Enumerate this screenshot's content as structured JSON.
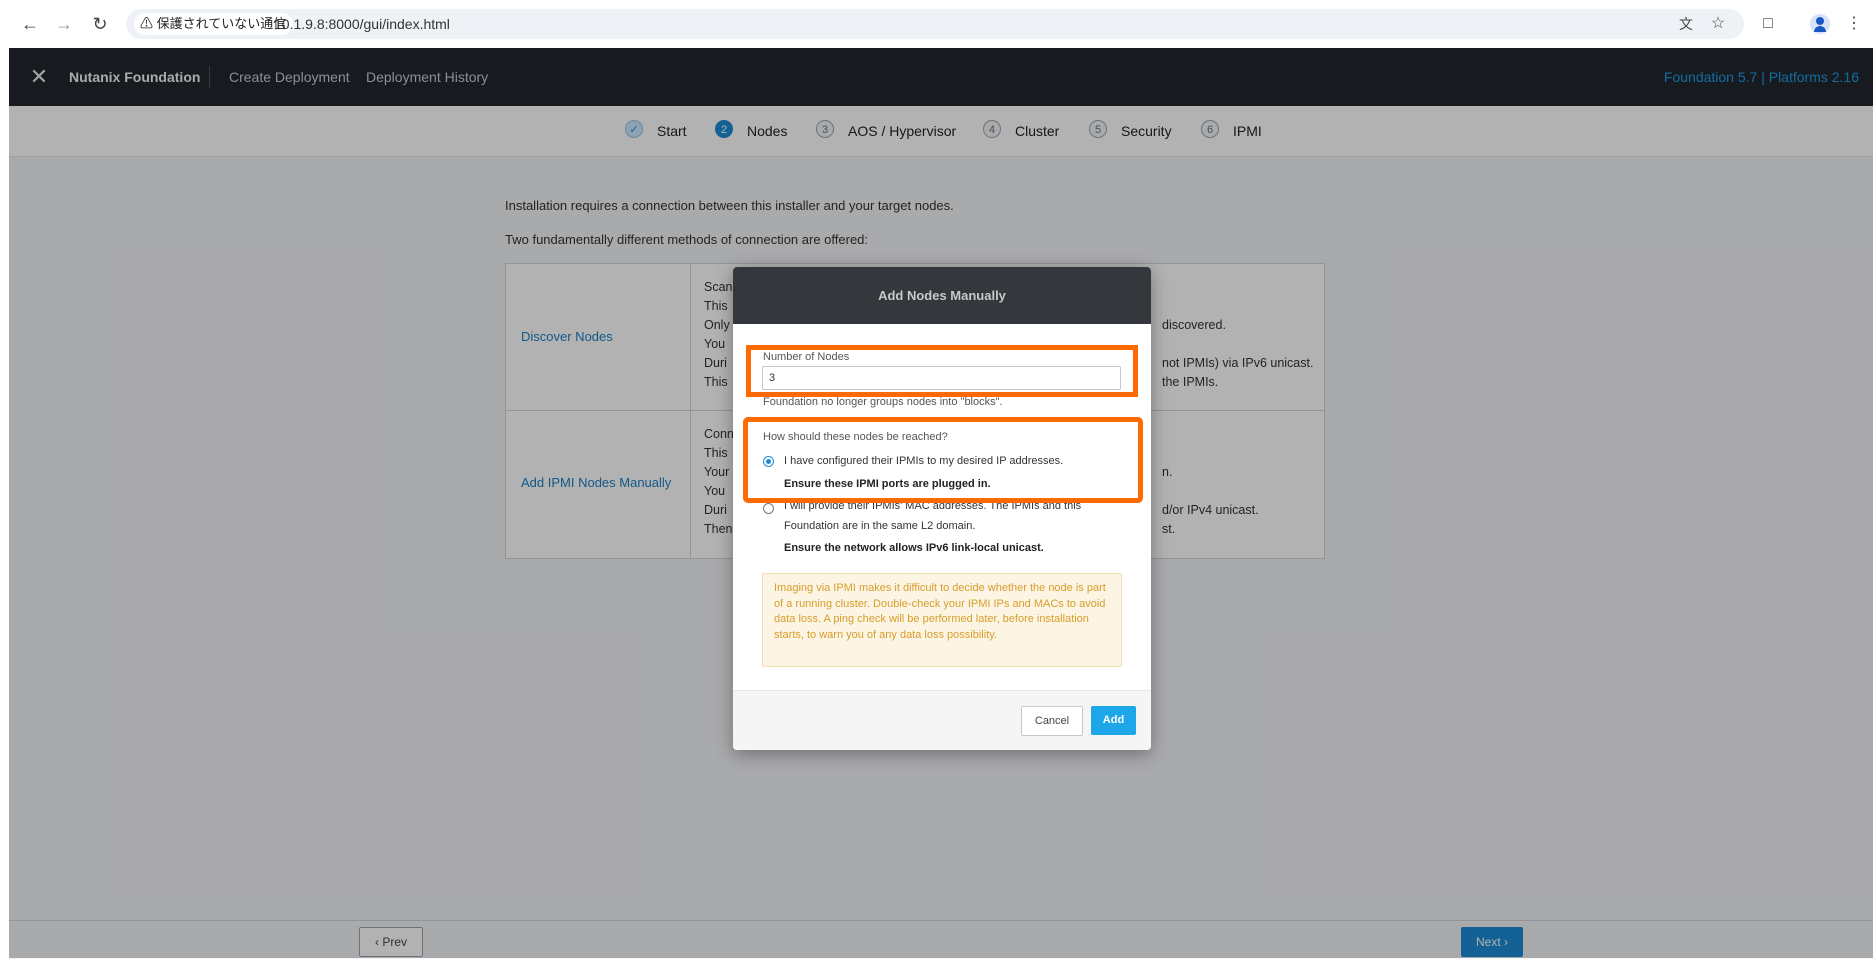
{
  "browser": {
    "security_warning": "⚠ 保護されていない通信",
    "url": "10.1.9.8:8000/gui/index.html"
  },
  "header": {
    "app_title": "Nutanix Foundation",
    "nav": [
      "Create Deployment",
      "Deployment History"
    ],
    "version": "Foundation 5.7 | Platforms 2.16"
  },
  "steps": [
    {
      "num": "✓",
      "label": "Start",
      "state": "done"
    },
    {
      "num": "2",
      "label": "Nodes",
      "state": "active"
    },
    {
      "num": "3",
      "label": "AOS / Hypervisor",
      "state": "todo"
    },
    {
      "num": "4",
      "label": "Cluster",
      "state": "todo"
    },
    {
      "num": "5",
      "label": "Security",
      "state": "todo"
    },
    {
      "num": "6",
      "label": "IPMI",
      "state": "todo"
    }
  ],
  "intro": {
    "line1": "Installation requires a connection between this installer and your target nodes.",
    "line2": "Two fundamentally different methods of connection are offered:"
  },
  "methods": {
    "discover": {
      "name": "Discover Nodes",
      "lines": [
        "Scan",
        "This",
        "Only",
        "You",
        "Duri",
        "This"
      ],
      "tails": [
        "discovered.",
        "not IPMIs) via IPv6 unicast.",
        "the IPMIs."
      ]
    },
    "manual": {
      "name": "Add IPMI Nodes Manually",
      "lines": [
        "Conn",
        "This",
        "Your",
        "You",
        "Duri",
        "Then"
      ],
      "tails": [
        "n.",
        "d/or IPv4 unicast.",
        "st."
      ]
    }
  },
  "footer": {
    "prev": "Prev",
    "next": "Next"
  },
  "modal": {
    "title": "Add Nodes Manually",
    "num_nodes_label": "Number of Nodes",
    "num_nodes_value": "3",
    "num_nodes_hint": "Foundation no longer groups nodes into \"blocks\".",
    "reach_label": "How should these nodes be reached?",
    "option1_text": "I have configured their IPMIs to my desired IP addresses.",
    "option1_bold": "Ensure these IPMI ports are plugged in.",
    "option2_text_line1": "I will provide their IPMIs' MAC addresses. The IPMIs and this",
    "option2_text_line2": "Foundation are in the same L2 domain.",
    "option2_bold": "Ensure the network allows IPv6 link-local unicast.",
    "warning": "Imaging via IPMI makes it difficult to decide whether the node is part of a running cluster. Double-check your IPMI IPs and MACs to avoid data loss. A ping check will be performed later, before installation starts, to warn you of any data loss possibility.",
    "cancel": "Cancel",
    "add": "Add"
  },
  "colors": {
    "highlight": "#ff6a00",
    "accent": "#1c8bd6",
    "header_bg": "#22272e"
  },
  "icons": [
    "back-arrow-icon",
    "forward-arrow-icon",
    "reload-icon",
    "translate-icon",
    "star-icon",
    "extensions-icon",
    "profile-icon",
    "menu-icon",
    "nutanix-logo-icon"
  ]
}
